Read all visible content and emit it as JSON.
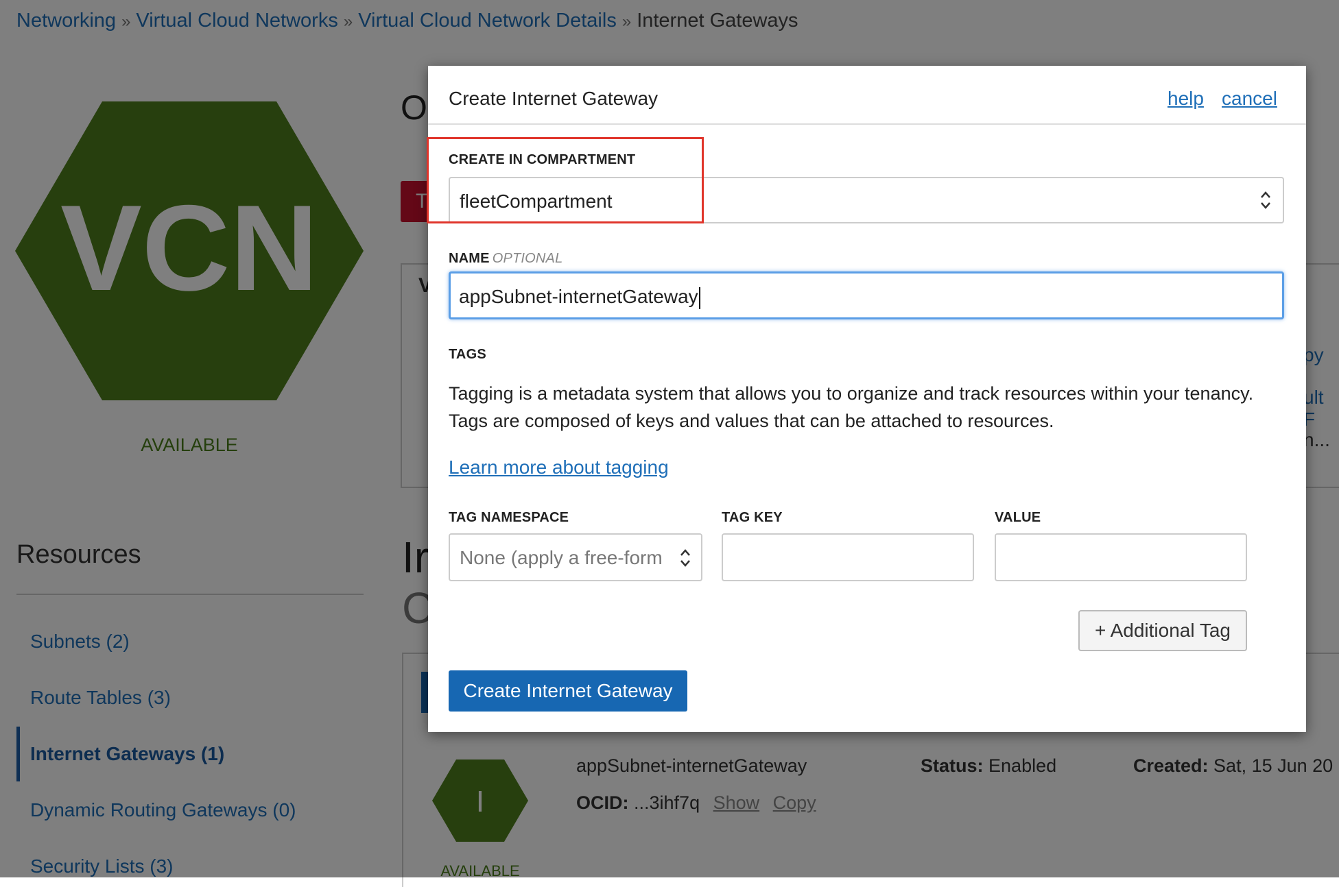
{
  "breadcrumb": {
    "items": [
      "Networking",
      "Virtual Cloud Networks",
      "Virtual Cloud Network Details"
    ],
    "separator": "»",
    "current": "Internet Gateways"
  },
  "vcn": {
    "label": "VCN",
    "status": "AVAILABLE",
    "color": "#4e7f1c"
  },
  "resources": {
    "title": "Resources",
    "items": [
      {
        "label": "Subnets (2)"
      },
      {
        "label": "Route Tables (3)"
      },
      {
        "label": "Internet Gateways (1)",
        "active": true
      },
      {
        "label": "Dynamic Routing Gateways (0)"
      },
      {
        "label": "Security Lists (3)"
      }
    ]
  },
  "background": {
    "heading_fragment": "O",
    "button_fragment": "Te",
    "panel_fragment": "V",
    "right_fragments": [
      "py",
      "ult F",
      "n..."
    ],
    "section_fragment_1": "Ir",
    "section_fragment_2": "C"
  },
  "gateway": {
    "icon_letter": "I",
    "name": "appSubnet-internetGateway",
    "ocid_label": "OCID:",
    "ocid_value": "...3ihf7q",
    "show_link": "Show",
    "copy_link": "Copy",
    "status_label": "Status:",
    "status_value": "Enabled",
    "created_label": "Created:",
    "created_value": "Sat, 15 Jun 20",
    "badge": "AVAILABLE"
  },
  "modal": {
    "title": "Create Internet Gateway",
    "help": "help",
    "cancel": "cancel",
    "compartment_label": "CREATE IN COMPARTMENT",
    "compartment_value": "fleetCompartment",
    "name_label": "NAME",
    "name_optional": "OPTIONAL",
    "name_value": "appSubnet-internetGateway",
    "tags_label": "TAGS",
    "tags_description": "Tagging is a metadata system that allows you to organize and track resources within your tenancy. Tags are composed of keys and values that can be attached to resources.",
    "learn_more": "Learn more about tagging",
    "tag_namespace_label": "TAG NAMESPACE",
    "tag_key_label": "TAG KEY",
    "value_label": "VALUE",
    "tag_namespace_value": "None (apply a free-form",
    "additional_tag": "+ Additional Tag",
    "submit": "Create Internet Gateway"
  },
  "colors": {
    "link": "#1f6fb8",
    "primary_button": "#1767b2",
    "highlight": "#e0352b",
    "available_green": "#4a7f1a"
  }
}
